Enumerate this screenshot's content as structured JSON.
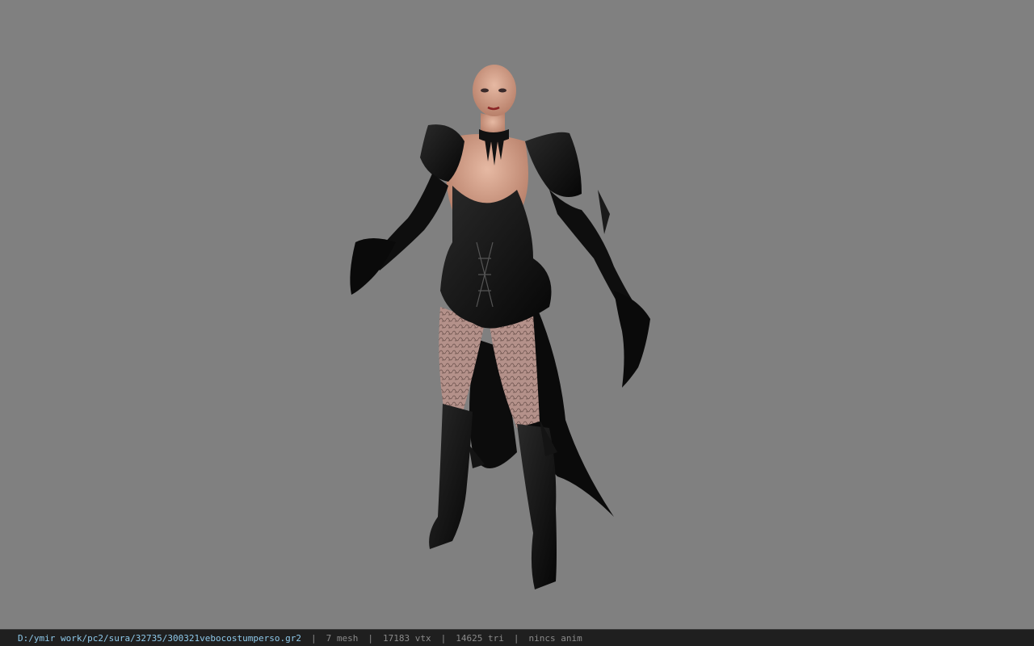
{
  "status_bar": {
    "file_path": "D:/ymir work/pc2/sura/32735/300321vebocostumperso.gr2",
    "separator": "|",
    "mesh_count": "7 mesh",
    "vertex_count": "17183 vtx",
    "triangle_count": "14625 tri",
    "animation": "nincs anim"
  },
  "viewport": {
    "background_color": "#808080",
    "model_description_icon": "female-character-3d-model"
  },
  "colors": {
    "path_text": "#8ec9ea",
    "stat_text": "#8a8a8a",
    "status_bar_bg": "#1f1f1f",
    "armor": "#111111",
    "skin": "#d9a38a"
  }
}
